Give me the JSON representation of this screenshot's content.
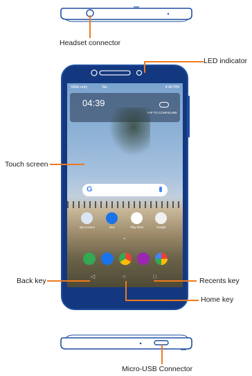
{
  "callouts": {
    "headset": "Headset connector",
    "led": "LED indicator",
    "touch": "Touch screen",
    "back": "Back key",
    "recents": "Recents key",
    "home": "Home key",
    "usb": "Micro-USB Connector"
  },
  "screen": {
    "status_left": "SIMs only",
    "status_mid": "No",
    "status_right": "4:40 PM",
    "clock": "04:39",
    "tap_label": "TAP TO CONFIGURE",
    "apps": [
      "My Account",
      "Duo",
      "Play Store",
      "Google"
    ]
  },
  "colors": {
    "accent": "#ee7a1f",
    "phone_body": "#14387f"
  }
}
